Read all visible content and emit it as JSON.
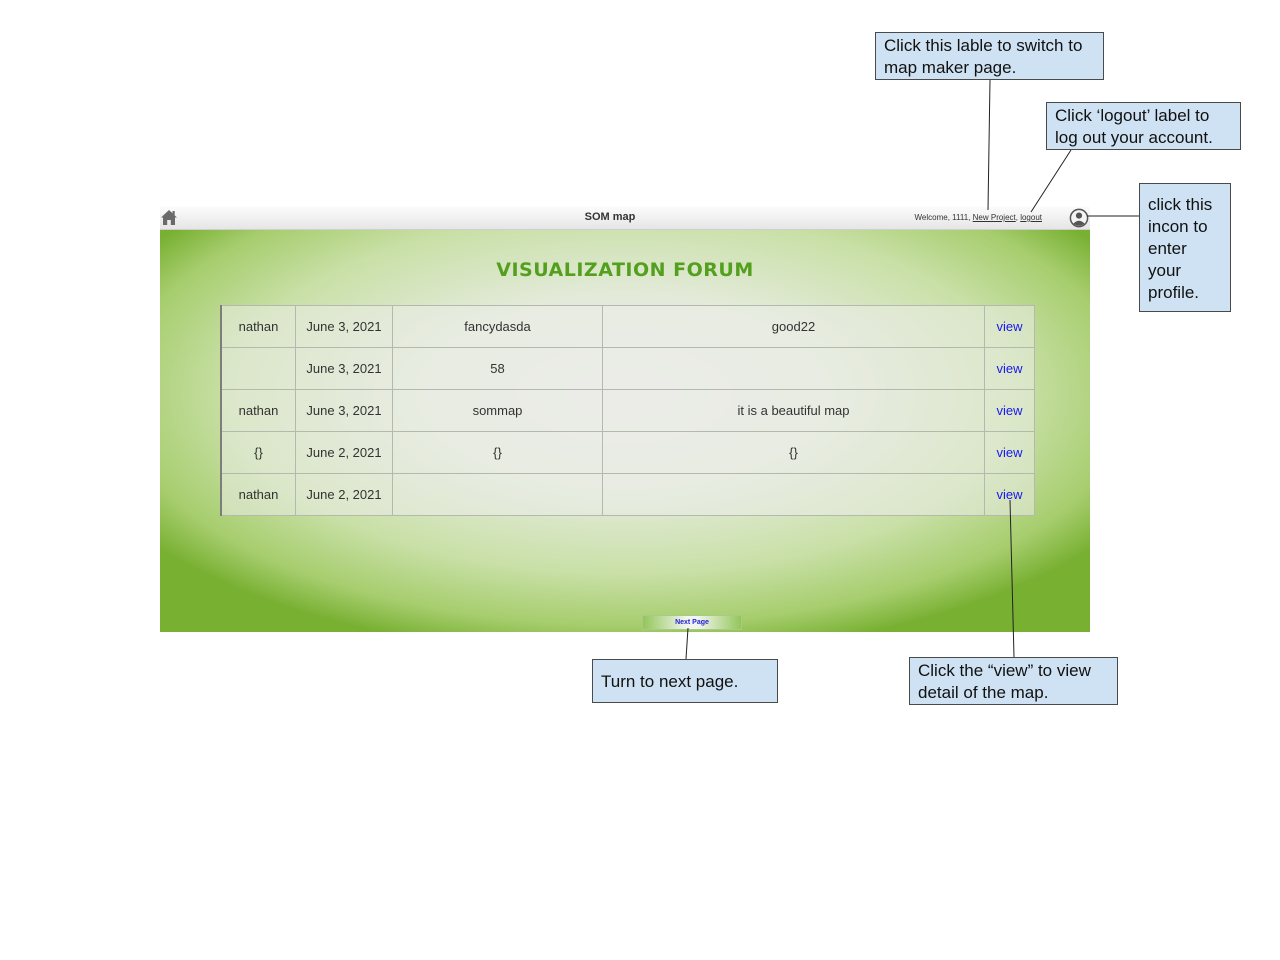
{
  "app": {
    "title": "SOM map",
    "welcome_text": "Welcome, 1111,",
    "new_project_label": "New Project",
    "logout_label": "logout",
    "icons": {
      "home": "home-icon",
      "profile": "user-circle-icon"
    }
  },
  "forum": {
    "title": "VISUALIZATION FORUM",
    "rows": [
      {
        "user": "nathan",
        "date": "June 3, 2021",
        "title": "fancydasda",
        "description": "good22",
        "action": "view"
      },
      {
        "user": "",
        "date": "June 3, 2021",
        "title": "58",
        "description": "",
        "action": "view"
      },
      {
        "user": "nathan",
        "date": "June 3, 2021",
        "title": "sommap",
        "description": "it is a beautiful map",
        "action": "view"
      },
      {
        "user": "{}",
        "date": "June 2, 2021",
        "title": "{}",
        "description": "{}",
        "action": "view"
      },
      {
        "user": "nathan",
        "date": "June 2, 2021",
        "title": "",
        "description": "",
        "action": "view"
      }
    ],
    "next_page_label": "Next Page"
  },
  "annotations": {
    "new_project": "Click this lable to switch to map maker page.",
    "logout": "Click ‘logout’ label to log out your account.",
    "profile": "click this incon to enter your profile.",
    "next_page": "Turn to next page.",
    "view": "Click the “view” to view detail of the map."
  },
  "colors": {
    "forum_title": "#54a01e",
    "view_link": "#1818ee",
    "annotation_fill": "#cfe2f3",
    "background_green": "#78b032"
  }
}
